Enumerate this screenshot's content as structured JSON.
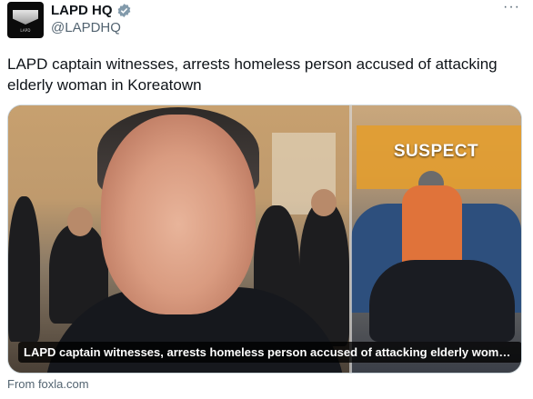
{
  "tweet": {
    "author_name": "LAPD HQ",
    "author_handle": "@LAPDHQ",
    "more_icon": "more-horizontal-icon",
    "verified_icon": "verified-badge-icon",
    "verified_color": "#829aab",
    "text": "LAPD captain witnesses, arrests homeless person accused of attacking elderly woman in Koreatown"
  },
  "card": {
    "overlay_label": "SUSPECT",
    "caption": "LAPD captain witnesses, arrests homeless person accused of attacking elderly woman i...",
    "source": "From foxla.com"
  },
  "colors": {
    "text_primary": "#0f1419",
    "text_secondary": "#536471",
    "border": "#cfd9de"
  }
}
